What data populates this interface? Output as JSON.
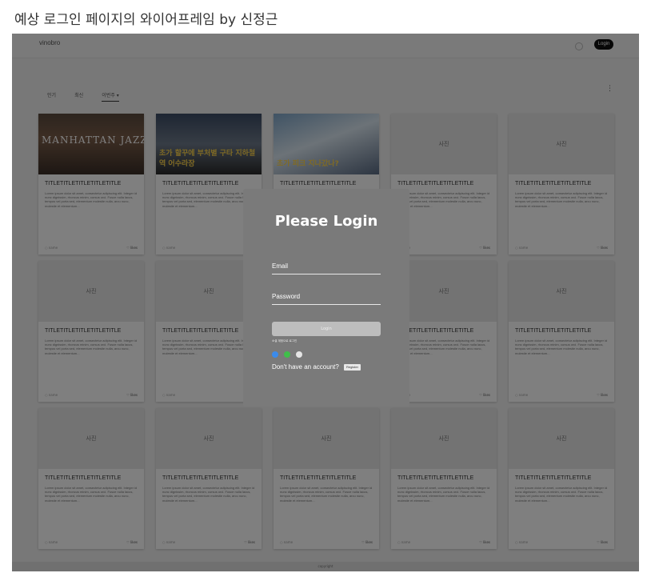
{
  "caption": "예상 로그인 페이지의 와이어프레임 by 신정근",
  "header": {
    "brand": "vinobro",
    "login_label": "Login"
  },
  "tabs": [
    {
      "label": "인기"
    },
    {
      "label": "최신"
    },
    {
      "label": "이번주 ▾"
    }
  ],
  "menu_icon": "⋮",
  "card_common": {
    "title": "TITLETITLETITLETITLETITLE",
    "desc": "Lorem ipsum dolor sit amet, consectetur adipiscing elit. Integer id nunc dignissim, rhoncus minim, cursus orci. Fusce nulla lacus, tempus vel porta sed, elementum molestie nulla, arcu nunc, molestie et elementum...",
    "footer_left": "○ name",
    "footer_right": "♡ likes",
    "placeholder": "사진"
  },
  "featured": [
    {
      "label": "MANHATTAN JAZZ"
    },
    {
      "label": "초가 할꾸에 부처별 구타 지하철역 어수라장"
    },
    {
      "label": "초가 피크 지나갔나?"
    }
  ],
  "modal": {
    "title": "Please Login",
    "email_label": "Email",
    "password_label": "Password",
    "login_button": "Login",
    "social_label": "소셜 계정으로 로그인",
    "social_colors": [
      "#3b8beb",
      "#3fbf4a",
      "#e5e5e5"
    ],
    "register_prompt": "Don't have an account?",
    "register_button": "Register"
  },
  "footer": "copyright"
}
